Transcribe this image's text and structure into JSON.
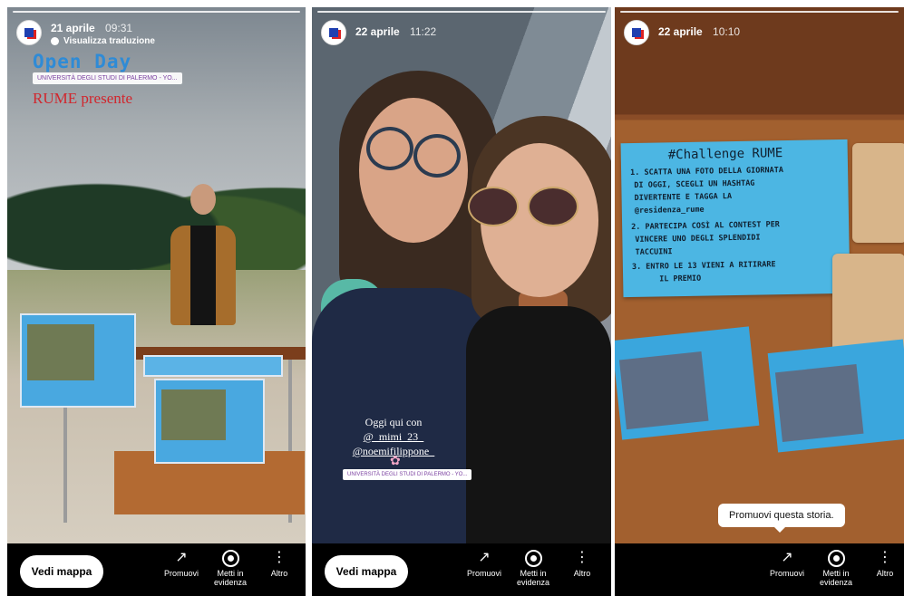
{
  "stories": [
    {
      "date": "21 aprile",
      "time": "09:31",
      "translate": "Visualizza traduzione",
      "overlay": {
        "title": "Open Day",
        "location": "UNIVERSITÀ DEGLI STUDI DI PALERMO - YO...",
        "subtitle": "RUME presente"
      },
      "map_button": "Vedi mappa",
      "actions": [
        {
          "label": "Promuovi",
          "icon": "trend-arrow-icon"
        },
        {
          "label": "Metti in evidenza",
          "icon": "heart-circle-icon"
        },
        {
          "label": "Altro",
          "icon": "more-vertical-icon"
        }
      ]
    },
    {
      "date": "22 aprile",
      "time": "11:22",
      "overlay": {
        "line1": "Oggi qui con",
        "mention1": "@_mimi_23_",
        "mention2": "@noemifilippone_",
        "location": "UNIVERSITÀ DEGLI STUDI DI PALERMO - YO..."
      },
      "map_button": "Vedi mappa",
      "actions": [
        {
          "label": "Promuovi",
          "icon": "trend-arrow-icon"
        },
        {
          "label": "Metti in evidenza",
          "icon": "heart-circle-icon"
        },
        {
          "label": "Altro",
          "icon": "more-vertical-icon"
        }
      ]
    },
    {
      "date": "22 aprile",
      "time": "10:10",
      "note": {
        "title": "#Challenge RUME",
        "lines": [
          "1. SCATTA UNA FOTO DELLA GIORNATA",
          "DI OGGI, SCEGLI UN HASHTAG",
          "DIVERTENTE E TAGGA LA",
          "@residenza_rume",
          "2. PARTECIPA COSÌ AL CONTEST PER",
          "VINCERE UNO DEGLI SPLENDIDI",
          "TACCUINI",
          "3. ENTRO LE 13 VIENI A RITIRARE",
          "IL PREMIO"
        ]
      },
      "tooltip": "Promuovi questa storia.",
      "actions": [
        {
          "label": "Promuovi",
          "icon": "trend-arrow-icon"
        },
        {
          "label": "Metti in evidenza",
          "icon": "heart-circle-icon"
        },
        {
          "label": "Altro",
          "icon": "more-vertical-icon"
        }
      ]
    }
  ]
}
